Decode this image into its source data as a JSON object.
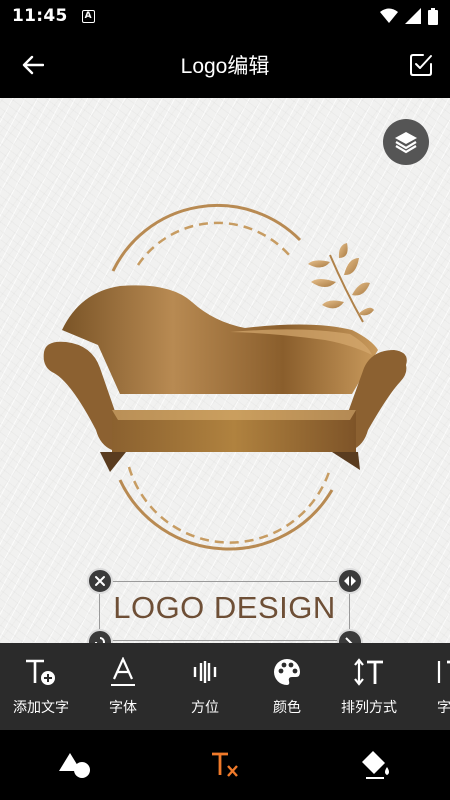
{
  "status_bar": {
    "time": "11:45",
    "notification_badge": "A"
  },
  "header": {
    "title": "Logo编辑"
  },
  "logo": {
    "text": "LOGO DESIGN"
  },
  "toolbar": {
    "items": [
      {
        "label": "添加文字",
        "icon": "add-text-icon"
      },
      {
        "label": "字体",
        "icon": "font-icon"
      },
      {
        "label": "方位",
        "icon": "align-icon"
      },
      {
        "label": "颜色",
        "icon": "palette-icon"
      },
      {
        "label": "排列方式",
        "icon": "text-direction-icon"
      },
      {
        "label": "字符",
        "icon": "character-spacing-icon"
      }
    ]
  },
  "bottom_nav": {
    "items": [
      {
        "name": "shapes",
        "icon": "shapes-icon",
        "active": false
      },
      {
        "name": "text",
        "icon": "text-clear-icon",
        "active": true
      },
      {
        "name": "fill",
        "icon": "paint-bucket-icon",
        "active": false
      }
    ]
  },
  "colors": {
    "accent": "#f07a2a",
    "logo_gold": "#a8763a",
    "logo_text": "#6e4f36",
    "toolbar_bg": "#2b2b2b"
  }
}
